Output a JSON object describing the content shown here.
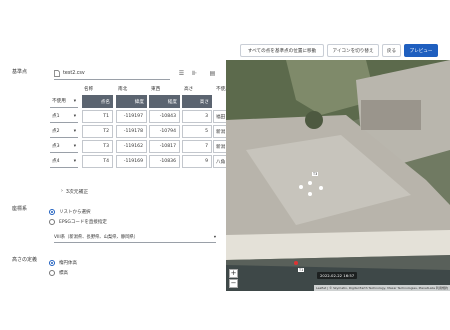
{
  "toolbar": {
    "move_all_label": "すべての点を基準点の位置に移動",
    "toggle_icons_label": "アイコンを切り替え",
    "back_label": "戻る",
    "preview_label": "プレビュー"
  },
  "reference_points": {
    "section_label": "基準点",
    "file_name": "test2.csv",
    "columns": [
      "名称",
      "南北",
      "東西",
      "高さ",
      "不使用"
    ],
    "header_select": "不使用",
    "header_row": [
      "点名",
      "緯度",
      "経度",
      "高さ"
    ],
    "rows": [
      {
        "point": "点1",
        "name": "T1",
        "ns": "-119197",
        "ew": "-10843",
        "height": "3",
        "use": "福田"
      },
      {
        "point": "点2",
        "name": "T2",
        "ns": "-119178",
        "ew": "-10794",
        "height": "5",
        "use": "新潟"
      },
      {
        "point": "点3",
        "name": "T3",
        "ns": "-119162",
        "ew": "-10817",
        "height": "7",
        "use": "新潟"
      },
      {
        "point": "点4",
        "name": "T4",
        "ns": "-119169",
        "ew": "-10836",
        "height": "9",
        "use": "八角"
      }
    ],
    "correction_label": "3次元補正"
  },
  "crs": {
    "section_label": "座標系",
    "option_list": "リストから選択",
    "option_epsg": "EPSGコードを直接指定",
    "selected": "VIII系（新潟県、長野県、山梨県、静岡県）"
  },
  "height_def": {
    "section_label": "高さの定義",
    "option_ellipsoid": "楕円体高",
    "option_orthometric": "標高"
  },
  "map": {
    "timestamp": "2022-02-22 16:57",
    "attribution": "Leaflet | © Skymatix, Digital Earth Technology, Maxar Technologies, PlanetLabs 利用規約",
    "zoom_in": "+",
    "zoom_out": "−",
    "marker_labels": [
      "T1",
      "T3"
    ]
  },
  "colors": {
    "primary": "#1f5fbf",
    "header_cell": "#5b6470"
  }
}
